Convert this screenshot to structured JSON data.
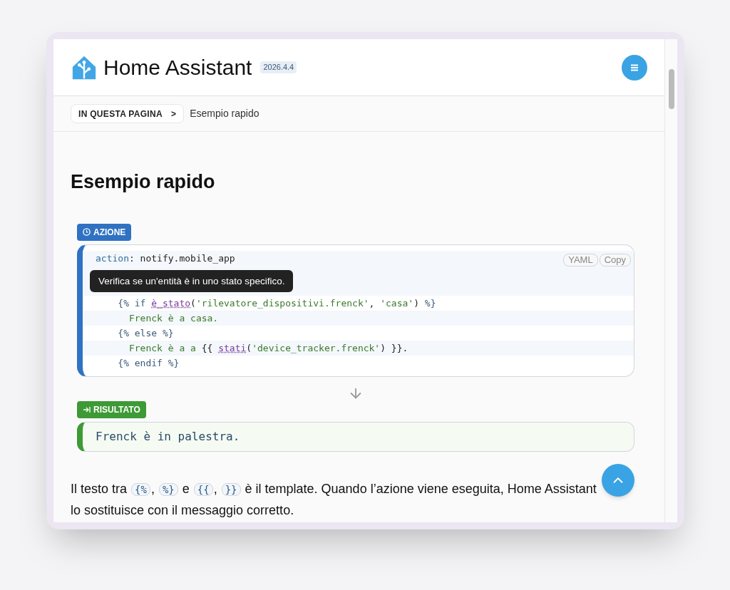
{
  "header": {
    "title": "Home Assistant",
    "version": "2026.4.4"
  },
  "breadcrumb": {
    "button": "IN QUESTA PAGINA",
    "chevron": ">",
    "current": "Esempio rapido"
  },
  "heading": "Esempio rapido",
  "action_block": {
    "label": "AZIONE",
    "buttons": [
      "YAML",
      "Copy"
    ],
    "tooltip": "Verifica se un'entità è in uno stato specifico.",
    "lines": [
      [
        {
          "kind": "key",
          "text": "action"
        },
        {
          "kind": "plain",
          "text": ": notify.mobile_app"
        }
      ],
      [
        {
          "kind": "tag",
          "text": "    {% if "
        },
        {
          "kind": "func",
          "text": "è_stato"
        },
        {
          "kind": "plain",
          "text": "("
        },
        {
          "kind": "string",
          "text": "'rilevatore_dispositivi.frenck'"
        },
        {
          "kind": "plain",
          "text": ", "
        },
        {
          "kind": "string",
          "text": "'casa'"
        },
        {
          "kind": "plain",
          "text": ") "
        },
        {
          "kind": "tag",
          "text": "%}"
        }
      ],
      [
        {
          "kind": "string",
          "text": "      Frenck è a casa."
        }
      ],
      [
        {
          "kind": "tag",
          "text": "    {% else %}"
        }
      ],
      [
        {
          "kind": "string",
          "text": "      Frenck è a a "
        },
        {
          "kind": "plain",
          "text": "{{ "
        },
        {
          "kind": "func",
          "text": "stati"
        },
        {
          "kind": "plain",
          "text": "("
        },
        {
          "kind": "string",
          "text": "'device_tracker.frenck'"
        },
        {
          "kind": "plain",
          "text": ") }}."
        }
      ],
      [
        {
          "kind": "tag",
          "text": "    {% endif %}"
        }
      ]
    ]
  },
  "result_block": {
    "label": "RISULTATO",
    "text": "Frenck è in palestra."
  },
  "paragraph": [
    {
      "kind": "text",
      "text": "Il testo tra "
    },
    {
      "kind": "code",
      "text": "{%"
    },
    {
      "kind": "text",
      "text": ", "
    },
    {
      "kind": "code",
      "text": "%}"
    },
    {
      "kind": "text",
      "text": " e "
    },
    {
      "kind": "code",
      "text": "{{"
    },
    {
      "kind": "text",
      "text": ", "
    },
    {
      "kind": "code",
      "text": "}}"
    },
    {
      "kind": "text",
      "text": " è il template. Quando l’azione viene eseguita, Home Assistant lo sostituisce con il messaggio corretto."
    }
  ]
}
